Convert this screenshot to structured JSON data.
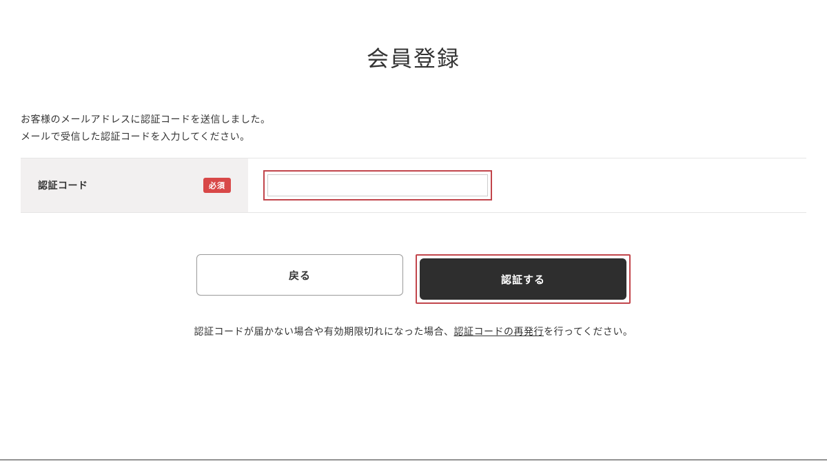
{
  "page": {
    "title": "会員登録"
  },
  "description": {
    "line1": "お客様のメールアドレスに認証コードを送信しました。",
    "line2": "メールで受信した認証コードを入力してください。"
  },
  "form": {
    "code_label": "認証コード",
    "required_badge": "必須",
    "code_value": ""
  },
  "buttons": {
    "back": "戻る",
    "submit": "認証する"
  },
  "reissue": {
    "prefix": "認証コードが届かない場合や有効期限切れになった場合、",
    "link": "認証コードの再発行",
    "suffix": "を行ってください。"
  }
}
